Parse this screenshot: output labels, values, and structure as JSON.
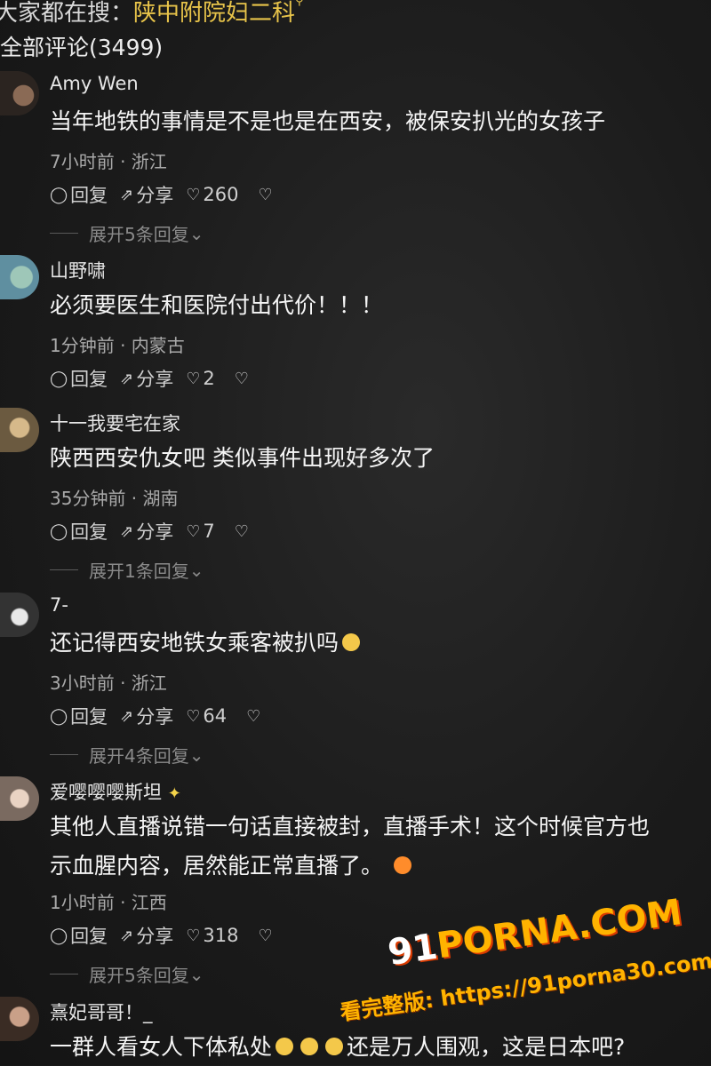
{
  "search": {
    "prefix": "大家都在搜：",
    "keyword": "陕中附院妇二科",
    "icon": "search-icon"
  },
  "comment_count": "全部评论(3499)",
  "labels": {
    "reply": "回复",
    "share": "分享"
  },
  "comments": [
    {
      "username": "Amy Wen",
      "content": "当年地铁的事情是不是也是在西安，被保安扒光的女孩子",
      "meta": "7小时前 · 浙江",
      "likes": "260",
      "expand": "展开5条回复"
    },
    {
      "username": "山野啸",
      "content": "必须要医生和医院付出代价！！！",
      "meta": "1分钟前 · 内蒙古",
      "likes": "2",
      "expand": ""
    },
    {
      "username": "十一我要宅在家",
      "content": "陕西西安仇女吧 类似事件出现好多次了",
      "meta": "35分钟前 · 湖南",
      "likes": "7",
      "expand": "展开1条回复"
    },
    {
      "username": "7-",
      "content": "还记得西安地铁女乘客被扒吗",
      "meta": "3小时前 · 浙江",
      "likes": "64",
      "expand": "展开4条回复"
    },
    {
      "username": "爱嘤嘤嘤斯坦",
      "content": "其他人直播说错一句话直接被封，直播手术！这个时候官方也",
      "content2": "示血腥内容，居然能正常直播了。",
      "meta": "1小时前 · 江西",
      "likes": "318",
      "expand": "展开5条回复"
    },
    {
      "username": "熹妃哥哥！_",
      "content": "一群人看女人下体私处",
      "content_suffix": "还是万人围观，这是日本吧?"
    }
  ],
  "watermark": {
    "logo_prefix": "91",
    "logo_main": "PORNA.COM",
    "url": "看完整版: https://91porna30.com"
  },
  "colors": {
    "background": "#1b1b1b",
    "keyword": "#e8c44a",
    "meta": "#a9a9a9",
    "watermark": "#ffb300"
  }
}
